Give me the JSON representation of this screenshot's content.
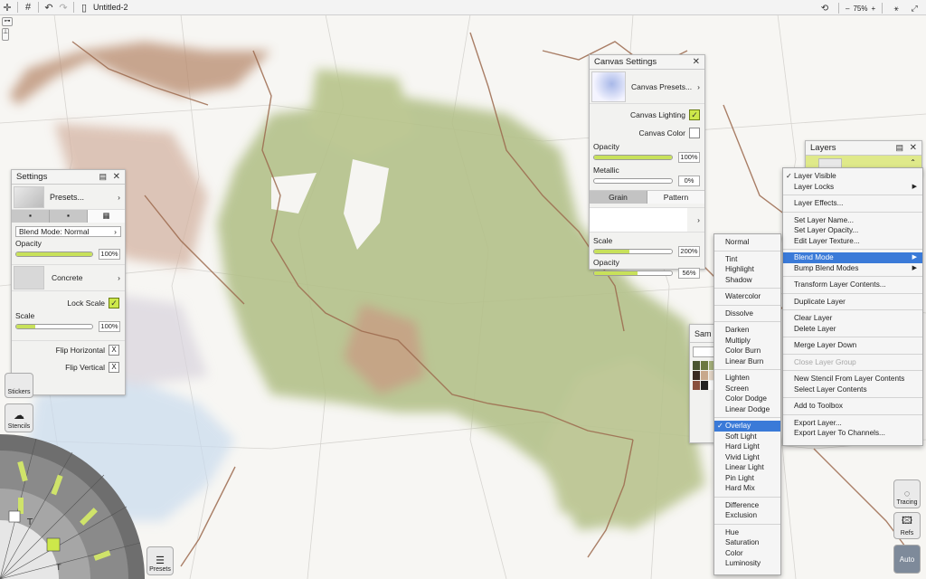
{
  "topbar": {
    "doc_title": "Untitled-2",
    "zoom_minus": "–",
    "zoom_value": "75%",
    "zoom_plus": "+"
  },
  "settings": {
    "title": "Settings",
    "presets_label": "Presets...",
    "blend_mode_label": "Blend Mode: Normal",
    "opacity_label": "Opacity",
    "opacity_value": "100%",
    "opacity_fraction": 1.0,
    "texture_label": "Concrete",
    "lock_scale_label": "Lock Scale",
    "scale_label": "Scale",
    "scale_value": "100%",
    "scale_fraction": 0.25,
    "flip_h_label": "Flip Horizontal",
    "flip_v_label": "Flip Vertical",
    "stickers_label": "Stickers",
    "stencils_label": "Stencils"
  },
  "canvas_settings": {
    "title": "Canvas Settings",
    "presets_label": "Canvas Presets...",
    "lighting_label": "Canvas Lighting",
    "color_label": "Canvas Color",
    "opacity_label": "Opacity",
    "opacity_value": "100%",
    "opacity_fraction": 1.0,
    "metallic_label": "Metallic",
    "metallic_value": "0%",
    "metallic_fraction": 0.0,
    "tab_grain": "Grain",
    "tab_pattern": "Pattern",
    "scale_label": "Scale",
    "scale_value": "200%",
    "scale_fraction": 0.45,
    "opacity2_label": "Opacity",
    "opacity2_value": "56%",
    "opacity2_fraction": 0.56
  },
  "layers": {
    "title": "Layers"
  },
  "samples": {
    "title_partial": "Sam"
  },
  "layer_menu": {
    "items": [
      {
        "label": "Layer Visible",
        "checked": true
      },
      {
        "label": "Layer Locks",
        "submenu": true
      },
      {
        "sep": true
      },
      {
        "label": "Layer Effects..."
      },
      {
        "sep": true
      },
      {
        "label": "Set Layer Name..."
      },
      {
        "label": "Set Layer Opacity..."
      },
      {
        "label": "Edit Layer Texture..."
      },
      {
        "sep": true
      },
      {
        "label": "Blend Mode",
        "submenu": true,
        "selected": true
      },
      {
        "label": "Bump Blend Modes",
        "submenu": true
      },
      {
        "sep": true
      },
      {
        "label": "Transform Layer Contents..."
      },
      {
        "sep": true
      },
      {
        "label": "Duplicate Layer"
      },
      {
        "sep": true
      },
      {
        "label": "Clear Layer"
      },
      {
        "label": "Delete Layer"
      },
      {
        "sep": true
      },
      {
        "label": "Merge Layer Down"
      },
      {
        "sep": true
      },
      {
        "label": "Close Layer Group",
        "disabled": true
      },
      {
        "sep": true
      },
      {
        "label": "New Stencil From Layer Contents"
      },
      {
        "label": "Select Layer Contents"
      },
      {
        "sep": true
      },
      {
        "label": "Add to Toolbox"
      },
      {
        "sep": true
      },
      {
        "label": "Export Layer..."
      },
      {
        "label": "Export Layer To Channels..."
      }
    ]
  },
  "blend_menu": {
    "items": [
      {
        "label": "Normal"
      },
      {
        "sep": true
      },
      {
        "label": "Tint"
      },
      {
        "label": "Highlight"
      },
      {
        "label": "Shadow"
      },
      {
        "sep": true
      },
      {
        "label": "Watercolor"
      },
      {
        "sep": true
      },
      {
        "label": "Dissolve"
      },
      {
        "sep": true
      },
      {
        "label": "Darken"
      },
      {
        "label": "Multiply"
      },
      {
        "label": "Color Burn"
      },
      {
        "label": "Linear Burn"
      },
      {
        "sep": true
      },
      {
        "label": "Lighten"
      },
      {
        "label": "Screen"
      },
      {
        "label": "Color Dodge"
      },
      {
        "label": "Linear Dodge"
      },
      {
        "sep": true
      },
      {
        "label": "Overlay",
        "checked": true,
        "selected": true
      },
      {
        "label": "Soft Light"
      },
      {
        "label": "Hard Light"
      },
      {
        "label": "Vivid Light"
      },
      {
        "label": "Linear Light"
      },
      {
        "label": "Pin Light"
      },
      {
        "label": "Hard Mix"
      },
      {
        "sep": true
      },
      {
        "label": "Difference"
      },
      {
        "label": "Exclusion"
      },
      {
        "sep": true
      },
      {
        "label": "Hue"
      },
      {
        "label": "Saturation"
      },
      {
        "label": "Color"
      },
      {
        "label": "Luminosity"
      }
    ]
  },
  "side_buttons": {
    "tracing": "Tracing",
    "refs": "Refs",
    "auto": "Auto",
    "presets": "Presets"
  },
  "colors": {
    "accent_green": "#c8e15a",
    "menu_highlight": "#3a7ad8",
    "map_green": "#a9b97a",
    "map_brown": "#b98a6c",
    "map_blue": "#bcd3ea",
    "river": "#9c6a4e"
  }
}
